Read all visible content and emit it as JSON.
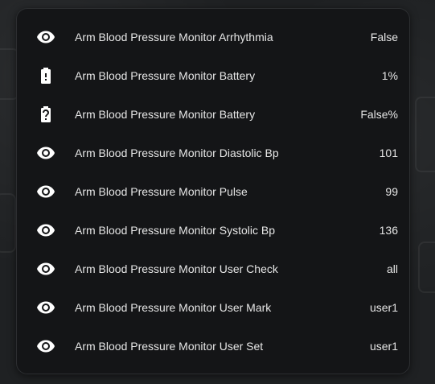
{
  "entities": [
    {
      "icon": "eye-icon",
      "name": "Arm Blood Pressure Monitor Arrhythmia",
      "value": "False"
    },
    {
      "icon": "battery-alert-icon",
      "name": "Arm Blood Pressure Monitor Battery",
      "value": "1%"
    },
    {
      "icon": "battery-unknown-icon",
      "name": "Arm Blood Pressure Monitor Battery",
      "value": "False%"
    },
    {
      "icon": "eye-icon",
      "name": "Arm Blood Pressure Monitor Diastolic Bp",
      "value": "101"
    },
    {
      "icon": "eye-icon",
      "name": "Arm Blood Pressure Monitor Pulse",
      "value": "99"
    },
    {
      "icon": "eye-icon",
      "name": "Arm Blood Pressure Monitor Systolic Bp",
      "value": "136"
    },
    {
      "icon": "eye-icon",
      "name": "Arm Blood Pressure Monitor User Check",
      "value": "all"
    },
    {
      "icon": "eye-icon",
      "name": "Arm Blood Pressure Monitor User Mark",
      "value": "user1"
    },
    {
      "icon": "eye-icon",
      "name": "Arm Blood Pressure Monitor User Set",
      "value": "user1"
    }
  ],
  "colors": {
    "card_background": "#141517",
    "page_background": "#1f2123",
    "text": "#e6e6e6",
    "icon": "#ffffff"
  }
}
